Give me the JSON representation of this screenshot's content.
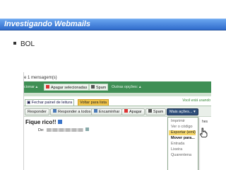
{
  "slide": {
    "title": "Investigando Webmails",
    "bullet": "BOL"
  },
  "screenshot": {
    "message_count": "e 1 mensagem(s)",
    "green_bar": {
      "move_label": "cionar",
      "delete_selected": "Apagar selecionadas",
      "spam": "Spam",
      "other_options": "Outras opções:"
    },
    "notice": "Você está usando",
    "tabs": {
      "close_panel": "Fechar painel de leitura",
      "back_to_list": "Voltar para lista"
    },
    "toolbar": {
      "reply": "Responder",
      "reply_all": "Responder a todos",
      "forward": "Encaminhar",
      "delete": "Apagar",
      "spam": "Spam",
      "more_actions": "Mais ações..."
    },
    "partial_right": "hes",
    "message": {
      "subject": "Fique rico!!",
      "from_label": "De:"
    },
    "more_actions_menu": {
      "items": [
        "Imprimir",
        "Ver o código",
        "Exportar (eml)",
        "Mover para...",
        "Entrada",
        "Lixeira",
        "Quarentena"
      ],
      "highlighted_index": 2,
      "header_index": 3
    }
  },
  "colors": {
    "title_bar": "#2f6bcc",
    "green_bar": "#3f8f55",
    "active_tab": "#f0c34a",
    "menu_highlight": "#f6d76a"
  }
}
